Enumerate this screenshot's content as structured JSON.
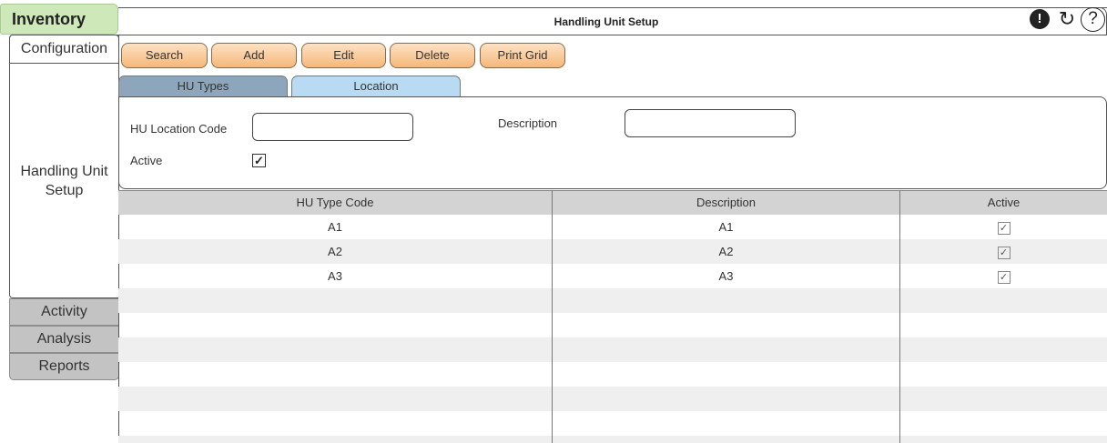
{
  "sidebar": {
    "module_title": "Inventory",
    "config_tab": "Configuration",
    "config_item": "Handling Unit Setup",
    "sections": [
      "Activity",
      "Analysis",
      "Reports"
    ]
  },
  "header": {
    "title": "Handling Unit Setup",
    "alert_glyph": "!",
    "refresh_glyph": "↻",
    "help_glyph": "?"
  },
  "toolbar": {
    "search": "Search",
    "add": "Add",
    "edit": "Edit",
    "delete": "Delete",
    "print_grid": "Print Grid"
  },
  "tabs": {
    "hu_types": "HU Types",
    "location": "Location"
  },
  "form": {
    "hu_location_code_label": "HU Location Code",
    "hu_location_code_value": "",
    "description_label": "Description",
    "description_value": "",
    "active_label": "Active",
    "active_checked": true,
    "check_glyph": "✓"
  },
  "grid": {
    "columns": [
      "HU Type Code",
      "Description",
      "Active"
    ],
    "rows": [
      {
        "code": "A1",
        "description": "A1",
        "active": "✓"
      },
      {
        "code": "A2",
        "description": "A2",
        "active": "✓"
      },
      {
        "code": "A3",
        "description": "A3",
        "active": "✓"
      },
      {
        "code": "",
        "description": "",
        "active": ""
      },
      {
        "code": "",
        "description": "",
        "active": ""
      },
      {
        "code": "",
        "description": "",
        "active": ""
      },
      {
        "code": "",
        "description": "",
        "active": ""
      },
      {
        "code": "",
        "description": "",
        "active": ""
      },
      {
        "code": "",
        "description": "",
        "active": ""
      },
      {
        "code": "",
        "description": "",
        "active": ""
      }
    ]
  },
  "colors": {
    "module_header": "#cfe8b9",
    "toolbar_button": "#f6b779",
    "tab_inactive": "#8ea6bc",
    "tab_active": "#b8daf3",
    "grid_header": "#d3d3d3"
  }
}
